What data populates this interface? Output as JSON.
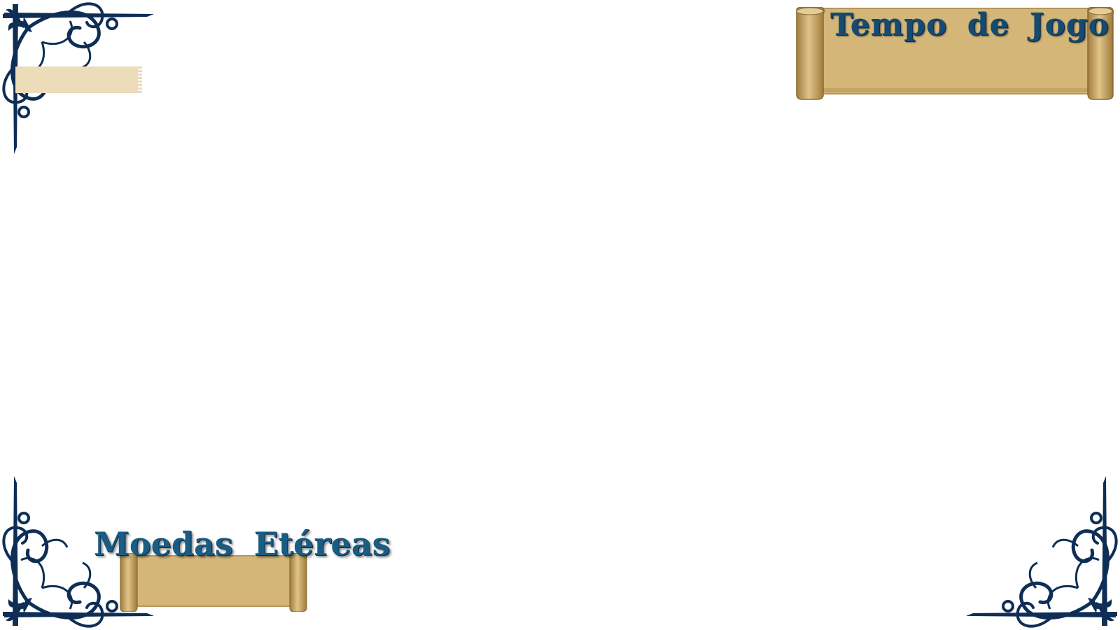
{
  "hud": {
    "play_time": {
      "label": "Tempo de Jogo",
      "value": ""
    },
    "ethereal_coins": {
      "label": "Moedas Etéreas",
      "value": ""
    },
    "top_left_slot": {
      "value": ""
    }
  },
  "colors": {
    "ornament": "#0e2e56",
    "parchment": "#d4b679",
    "parchment_dark": "#b8955a",
    "title_text": "#164a70",
    "slot_fill": "#ecdcba"
  },
  "icons": [
    "ornament-corner-top-left",
    "ornament-corner-bottom-left",
    "ornament-corner-bottom-right",
    "scroll-banner"
  ]
}
